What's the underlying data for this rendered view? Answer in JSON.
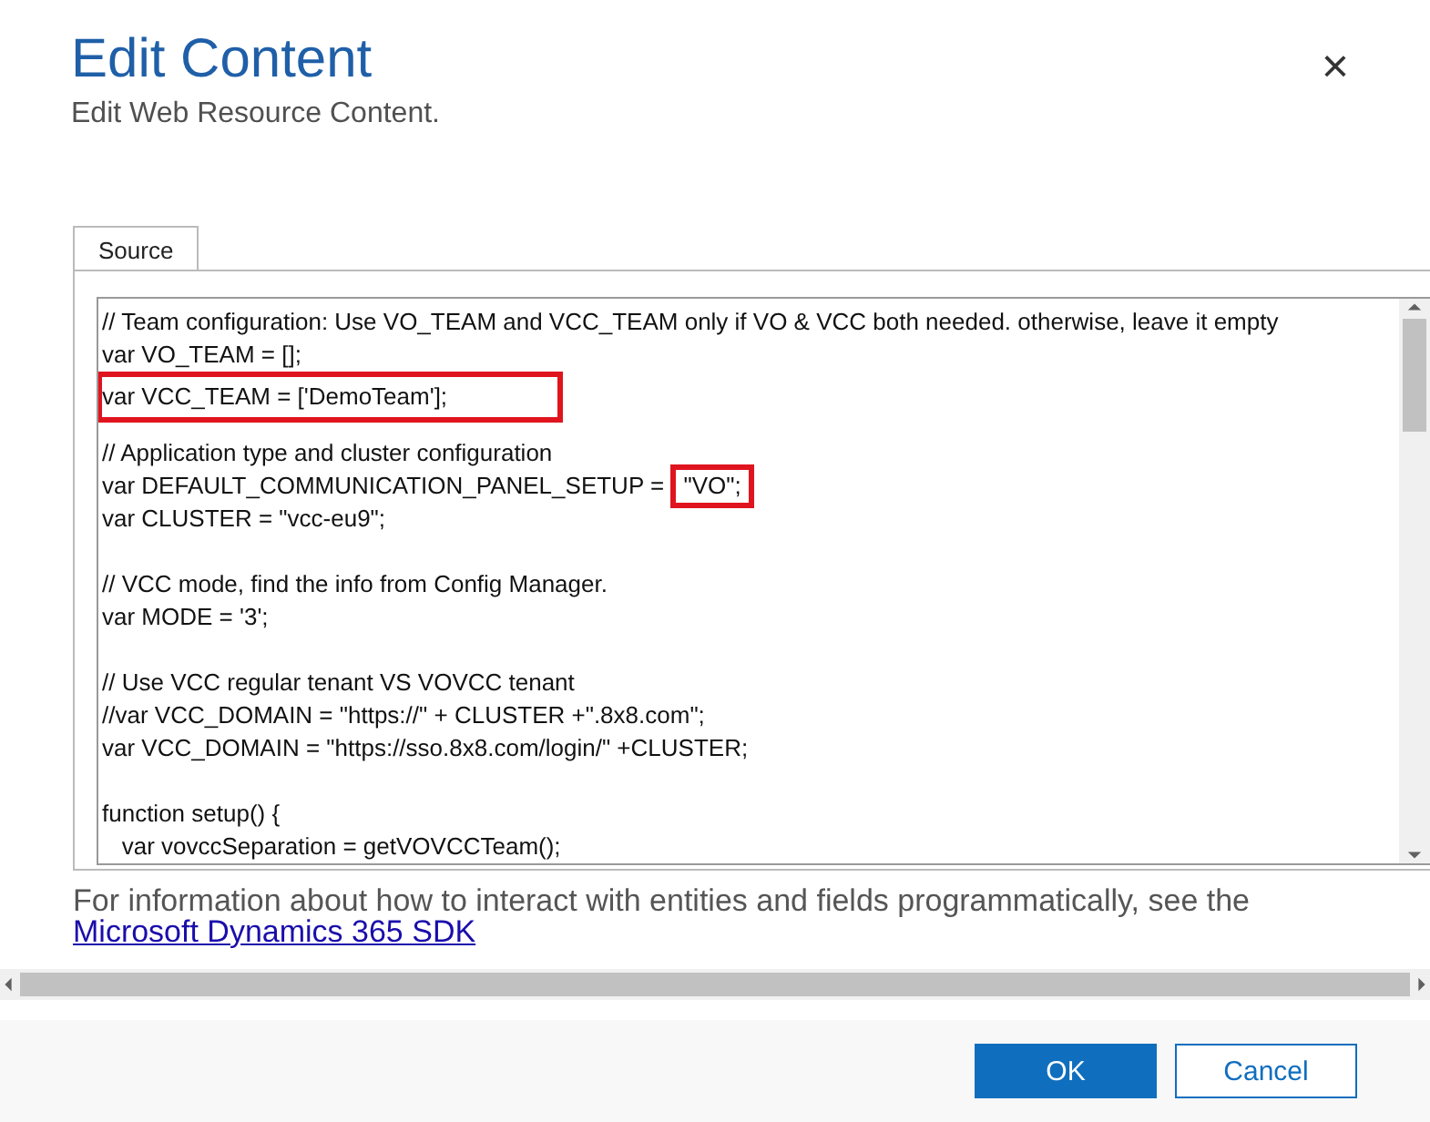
{
  "dialog": {
    "title": "Edit Content",
    "subtitle": "Edit Web Resource Content.",
    "close": "×"
  },
  "tabs": [
    {
      "label": "Source",
      "selected": true
    }
  ],
  "editor": {
    "blocks": [
      {
        "lines": [
          [
            {
              "text": "// Team configuration: Use VO_TEAM and VCC_TEAM only if VO & VCC both needed. otherwise, leave it empty"
            }
          ],
          [
            {
              "text": "var VO_TEAM = [];"
            }
          ],
          [
            {
              "text": "var VCC_TEAM = ['DemoTeam'];",
              "highlighted": true
            }
          ]
        ]
      },
      {
        "lines": [
          [
            {
              "text": "// Application type and cluster configuration"
            }
          ],
          [
            {
              "text": "var DEFAULT_COMMUNICATION_PANEL_SETUP = "
            },
            {
              "text": "\"VO\";",
              "highlighted": true
            }
          ],
          [
            {
              "text": "var CLUSTER = \"vcc-eu9\";"
            }
          ]
        ]
      },
      {
        "lines": [
          [
            {
              "text": "// VCC mode, find the info from Config Manager."
            }
          ],
          [
            {
              "text": "var MODE = '3';"
            }
          ]
        ]
      },
      {
        "lines": [
          [
            {
              "text": "// Use VCC regular tenant VS VOVCC tenant"
            }
          ],
          [
            {
              "text": "//var VCC_DOMAIN = \"https://\" + CLUSTER +\".8x8.com\";"
            }
          ],
          [
            {
              "text": "var VCC_DOMAIN = \"https://sso.8x8.com/login/\" +CLUSTER;"
            }
          ]
        ]
      },
      {
        "lines": [
          [
            {
              "text": "function setup() {"
            }
          ],
          [
            {
              "text": "   var vovccSeparation = getVOVCCTeam();"
            }
          ]
        ]
      }
    ]
  },
  "info": {
    "text": "For information about how to interact with entities and fields programmatically, see the",
    "link": "Microsoft Dynamics 365 SDK"
  },
  "buttons": [
    {
      "label": "OK",
      "kind": "primary"
    },
    {
      "label": "Cancel",
      "kind": "secondary"
    }
  ]
}
